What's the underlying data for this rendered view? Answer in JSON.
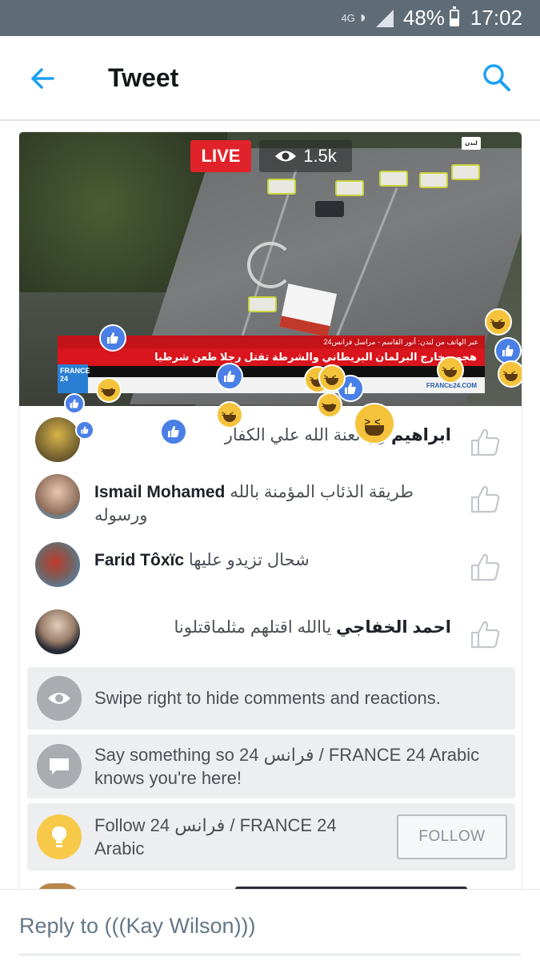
{
  "status_bar": {
    "network": "4G",
    "battery": "48%",
    "time": "17:02",
    "icons": [
      "wifi-icon",
      "signal-icon",
      "battery-icon"
    ]
  },
  "app_bar": {
    "title": "Tweet",
    "back_icon": "arrow-left-icon",
    "search_icon": "search-icon",
    "accent_color": "#1da1f2"
  },
  "video": {
    "live_label": "LIVE",
    "viewers": "1.5k",
    "channel_tag": "لندن",
    "ticker_small": "عبر الهاتف من لندن: أنور القاسم - مراسل فرانس24",
    "ticker_headline": "هجوم خارج البرلمان البريطاني والشرطة تقتل رجلا طعن شرطيا",
    "ticker_url": "FRANCE24.COM",
    "logo": "FRANCE 24"
  },
  "comments": [
    {
      "author": "ابراهيم",
      "text": "وي لعنة الله علي الكفار"
    },
    {
      "author": "Ismail Mohamed",
      "text": "طريقة الذئاب المؤمنة بالله ورسوله"
    },
    {
      "author": "Farid Tôxïc",
      "text": "شحال تزيدو عليها"
    },
    {
      "author": "احمد الخفاجي",
      "text": "ياالله اقتلهم مثلماقتلونا"
    }
  ],
  "info_rows": {
    "hide_hint": "Swipe right to hide comments and reactions.",
    "say_something": "Say something so 24 فرانس / FRANCE 24 Arabic knows you're here!",
    "follow_prompt": "Follow 24 فرانس / FRANCE 24 Arabic",
    "follow_button": "FOLLOW"
  },
  "reply": {
    "placeholder": "Reply to (((Kay Wilson)))"
  },
  "colors": {
    "live_red": "#e0232a",
    "like_blue": "#4a7fe6",
    "haha_yellow": "#f5c33b",
    "status_bar": "#5f6b75"
  }
}
